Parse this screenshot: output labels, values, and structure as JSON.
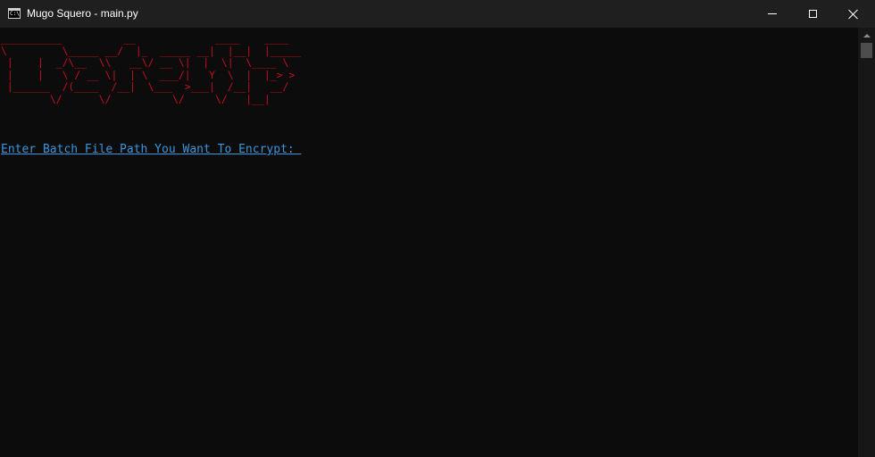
{
  "window": {
    "title": "Mugo Squero - main.py",
    "icon": "console-app-icon",
    "icon_glyph": "C:\\"
  },
  "console": {
    "banner_ascii": "__________          __             ____    ____\n\\         \\_____ __/  |_  _____ __|  |__|  |_____\n |    |  _/\\__  \\\\   __\\/ __ \\|  |  \\|  \\____ \\\n |    |   \\ / __ \\|  | \\  ___/|   Y  \\  |  |_> >\n |______  /(____  /__|  \\___  >___|  /__|   __/\n        \\/      \\/          \\/     \\/   |__|",
    "prompt_text": "Enter Batch File Path You Want To Encrypt: "
  },
  "colors": {
    "background": "#0c0c0c",
    "titlebar": "#1f1f1f",
    "banner": "#c50f1f",
    "prompt": "#3a96dd",
    "scrollbar_track": "#171717",
    "scrollbar_thumb": "#4d4d4d"
  }
}
